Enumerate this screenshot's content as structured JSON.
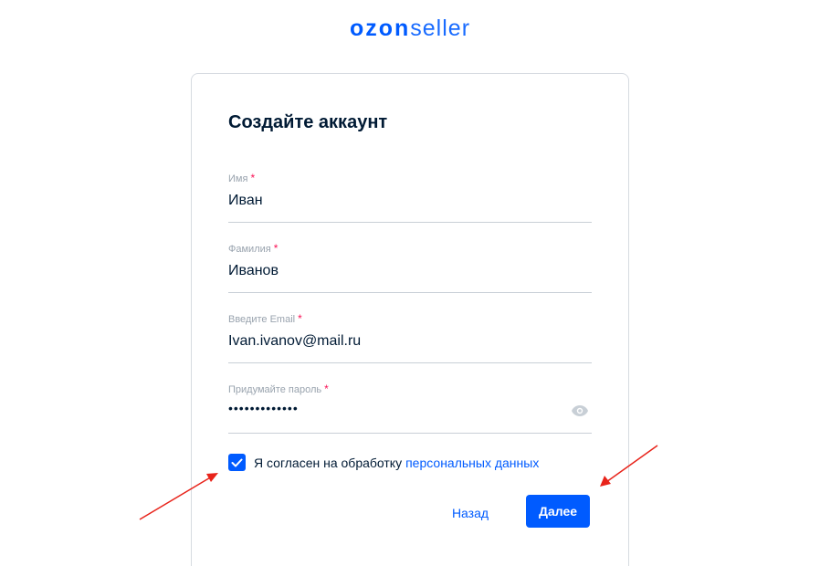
{
  "logo": {
    "brand": "ozon",
    "suffix": "seller"
  },
  "card": {
    "title": "Создайте аккаунт"
  },
  "fields": {
    "first_name": {
      "label": "Имя",
      "required_mark": "*",
      "value": "Иван"
    },
    "last_name": {
      "label": "Фамилия",
      "required_mark": "*",
      "value": "Иванов"
    },
    "email": {
      "label": "Введите Email",
      "required_mark": "*",
      "value": "Ivan.ivanov@mail.ru"
    },
    "password": {
      "label": "Придумайте пароль",
      "required_mark": "*",
      "value": "•••••••••••••",
      "icon": "eye-icon"
    }
  },
  "consent": {
    "checked": true,
    "text": "Я согласен на обработку",
    "link": "персональных данных"
  },
  "buttons": {
    "back": "Назад",
    "next": "Далее"
  },
  "colors": {
    "accent": "#005bff",
    "required": "#f91155",
    "annotation_arrow": "#e8231a"
  }
}
